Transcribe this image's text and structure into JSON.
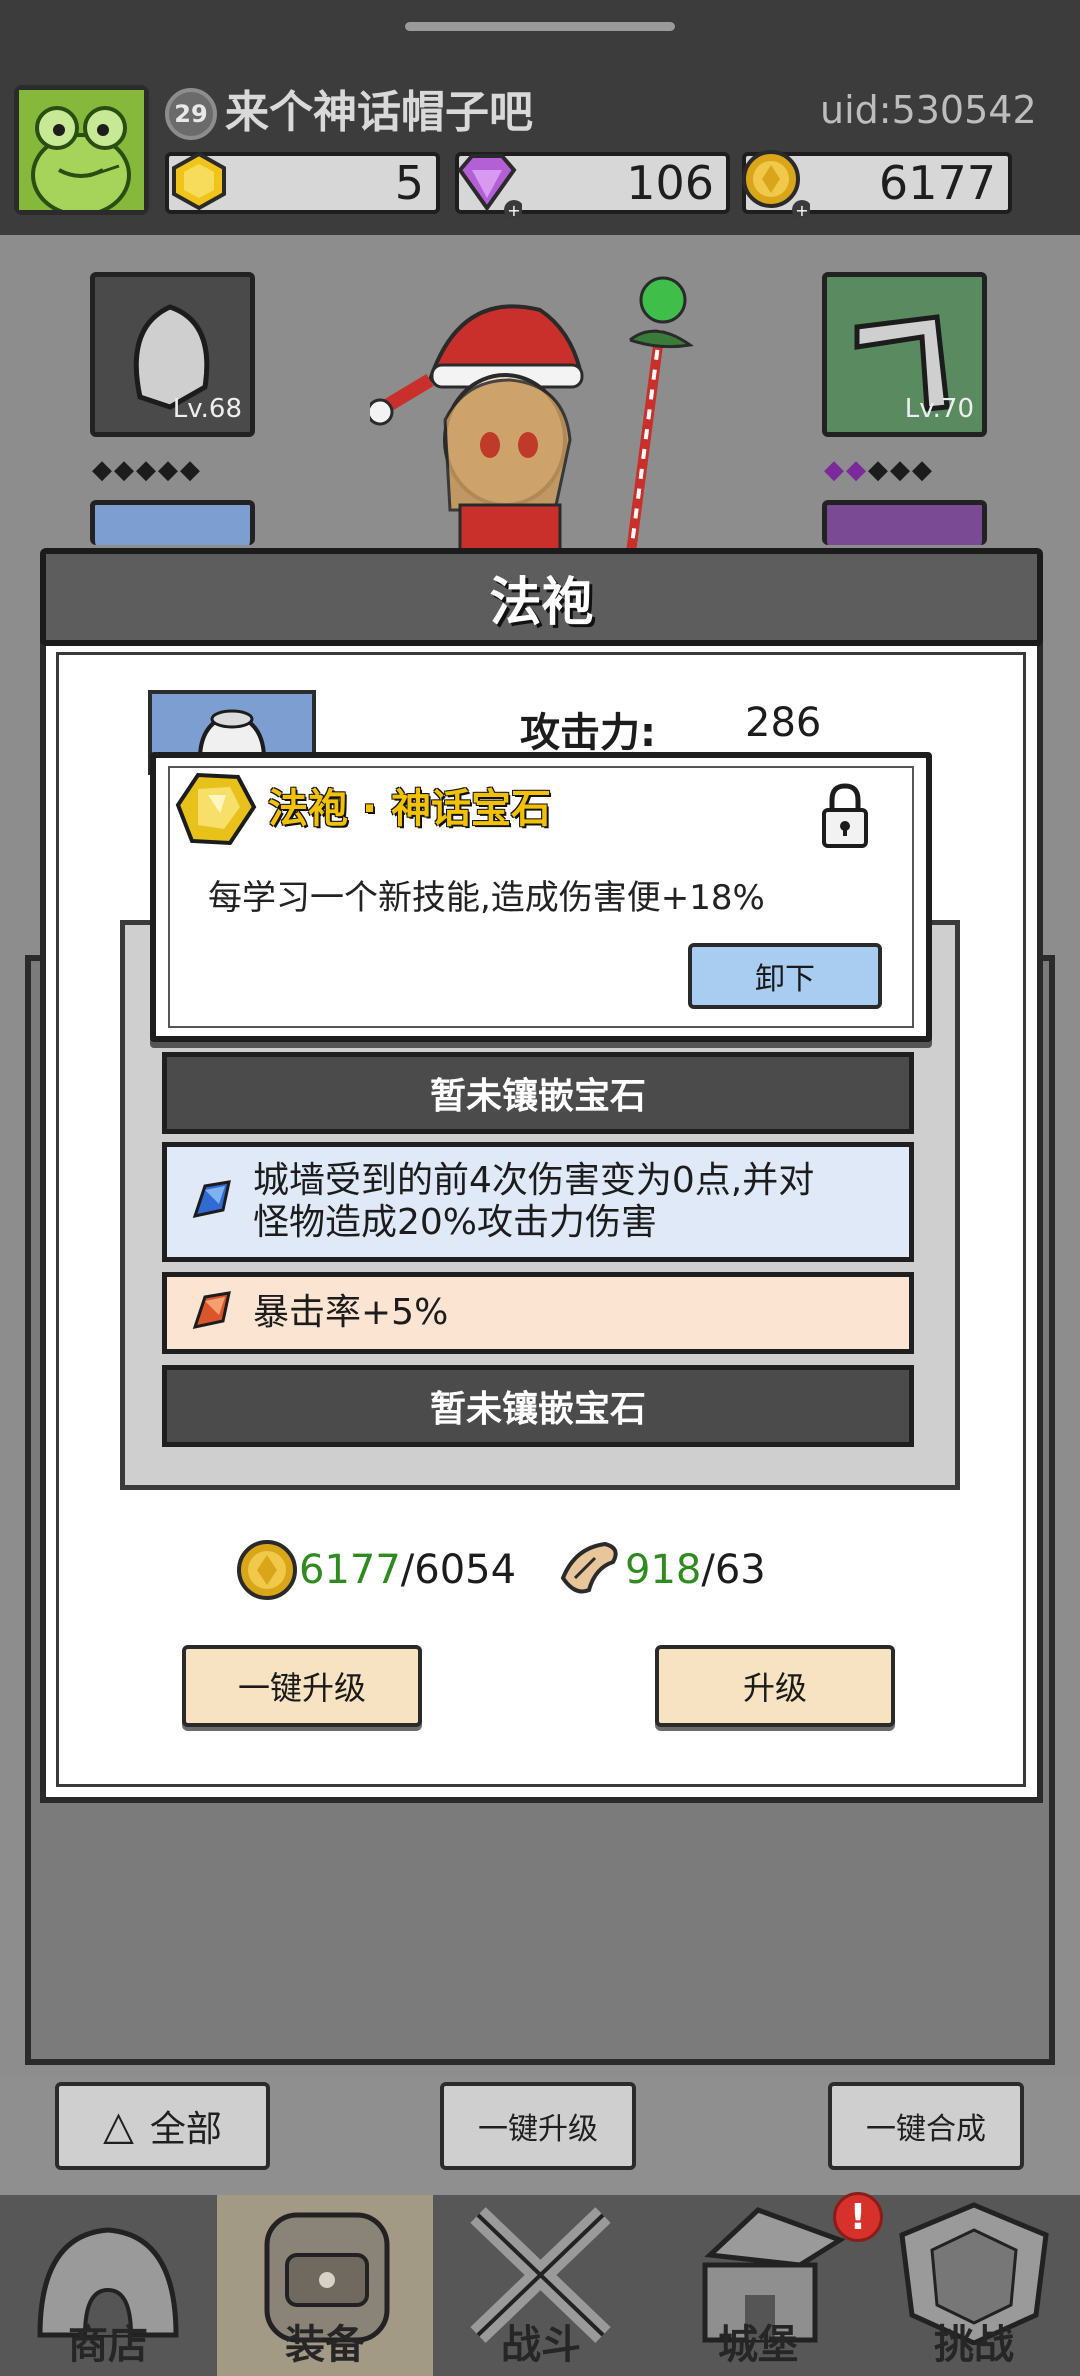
{
  "header": {
    "player_level": "29",
    "player_name": "来个神话帽子吧",
    "uid": "uid:530542",
    "resources": [
      {
        "icon": "gold-gem-icon",
        "value": "5"
      },
      {
        "icon": "purple-diamond-icon",
        "value": "106"
      },
      {
        "icon": "gold-coin-icon",
        "value": "6177"
      }
    ]
  },
  "equipment": {
    "left_slot_level": "Lv.68",
    "right_slot_level": "Lv.70"
  },
  "modal": {
    "title": "法袍",
    "attack_label": "攻击力:",
    "attack_value": "286",
    "tooltip": {
      "title": "法袍 · 神话宝石",
      "description": "每学习一个新技能,造成伤害便+18%",
      "unequip_label": "卸下"
    },
    "gem_slots": [
      {
        "type": "empty",
        "text": "暂未镶嵌宝石"
      },
      {
        "type": "blue",
        "line1": "城墙受到的前4次伤害变为0点,并对",
        "line2": "怪物造成20%攻击力伤害"
      },
      {
        "type": "orange",
        "text": "暴击率+5%"
      },
      {
        "type": "empty",
        "text": "暂未镶嵌宝石"
      }
    ],
    "costs": [
      {
        "icon": "gold-coin-icon",
        "have": "6177",
        "need": "/6054"
      },
      {
        "icon": "scroll-icon",
        "have": "918",
        "need": "/63"
      }
    ],
    "one_key_upgrade_label": "一键升级",
    "upgrade_label": "升级"
  },
  "actions": {
    "filter_label": "全部",
    "one_key_upgrade_label": "一键升级",
    "one_key_merge_label": "一键合成"
  },
  "nav": {
    "items": [
      {
        "label": "商店",
        "icon": "shop-icon"
      },
      {
        "label": "装备",
        "icon": "backpack-icon",
        "active": true
      },
      {
        "label": "战斗",
        "icon": "crossed-swords-icon"
      },
      {
        "label": "城堡",
        "icon": "castle-icon",
        "badge": "!"
      },
      {
        "label": "挑战",
        "icon": "crest-icon"
      }
    ]
  },
  "colors": {
    "header_bg": "#3c3c3c",
    "gold_text": "#f2c200",
    "cost_have_green": "#2f8a1f",
    "blue_slot": "#dfe9f7",
    "orange_slot": "#fbe4d2",
    "alert_red": "#d6322b"
  }
}
